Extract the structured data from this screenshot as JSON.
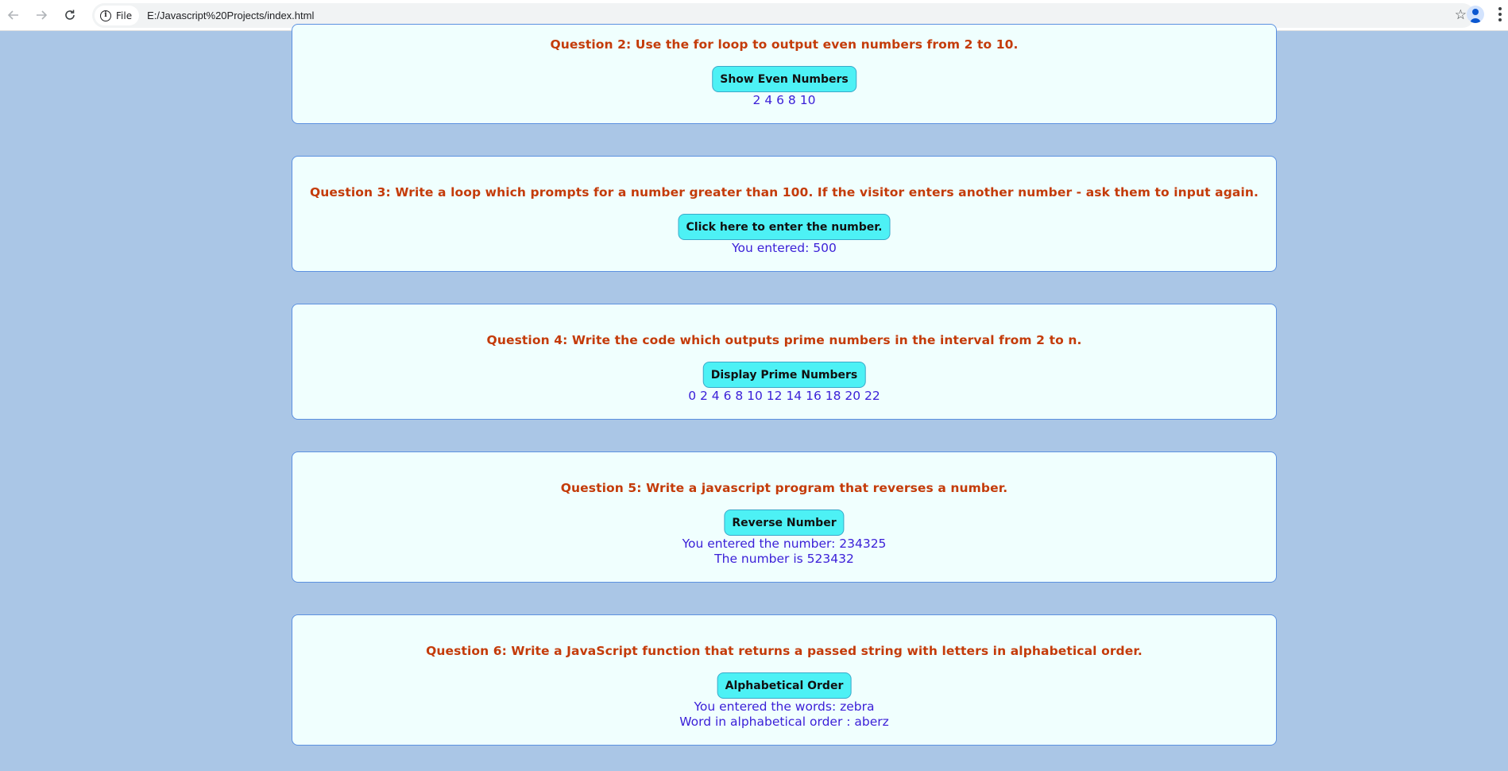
{
  "browser": {
    "back_icon": "arrow-left-icon",
    "forward_icon": "arrow-right-icon",
    "reload_icon": "reload-icon",
    "site_info_label": "File",
    "url": "E:/Javascript%20Projects/index.html",
    "bookmark_icon": "star-icon",
    "profile_icon": "profile-icon",
    "menu_icon": "menu-icon"
  },
  "questions": [
    {
      "text": "Question 2: Use the for loop to output even numbers from 2 to 10.",
      "button": "Show Even Numbers",
      "output": [
        "2 4 6 8 10"
      ]
    },
    {
      "text": "Question 3: Write a loop which prompts for a number greater than 100. If the visitor enters another number - ask them to input again.",
      "button": "Click here to enter the number.",
      "output": [
        "You entered: 500"
      ]
    },
    {
      "text": "Question 4: Write the code which outputs prime numbers in the interval from 2 to n.",
      "button": "Display Prime Numbers",
      "output": [
        "0 2 4 6 8 10 12 14 16 18 20 22"
      ]
    },
    {
      "text": "Question 5: Write a javascript program that reverses a number.",
      "button": "Reverse Number",
      "output": [
        "You entered the number: 234325",
        "The number is 523432"
      ]
    },
    {
      "text": "Question 6: Write a JavaScript function that returns a passed string with letters in alphabetical order.",
      "button": "Alphabetical Order",
      "output": [
        "You entered the words: zebra",
        "Word in alphabetical order : aberz"
      ]
    }
  ],
  "colors": {
    "page_background": "#aac6e6",
    "card_background": "#f0fffe",
    "question_text": "#c43b09",
    "button_background": "#4df1f5",
    "output_text": "#3b20d8"
  }
}
